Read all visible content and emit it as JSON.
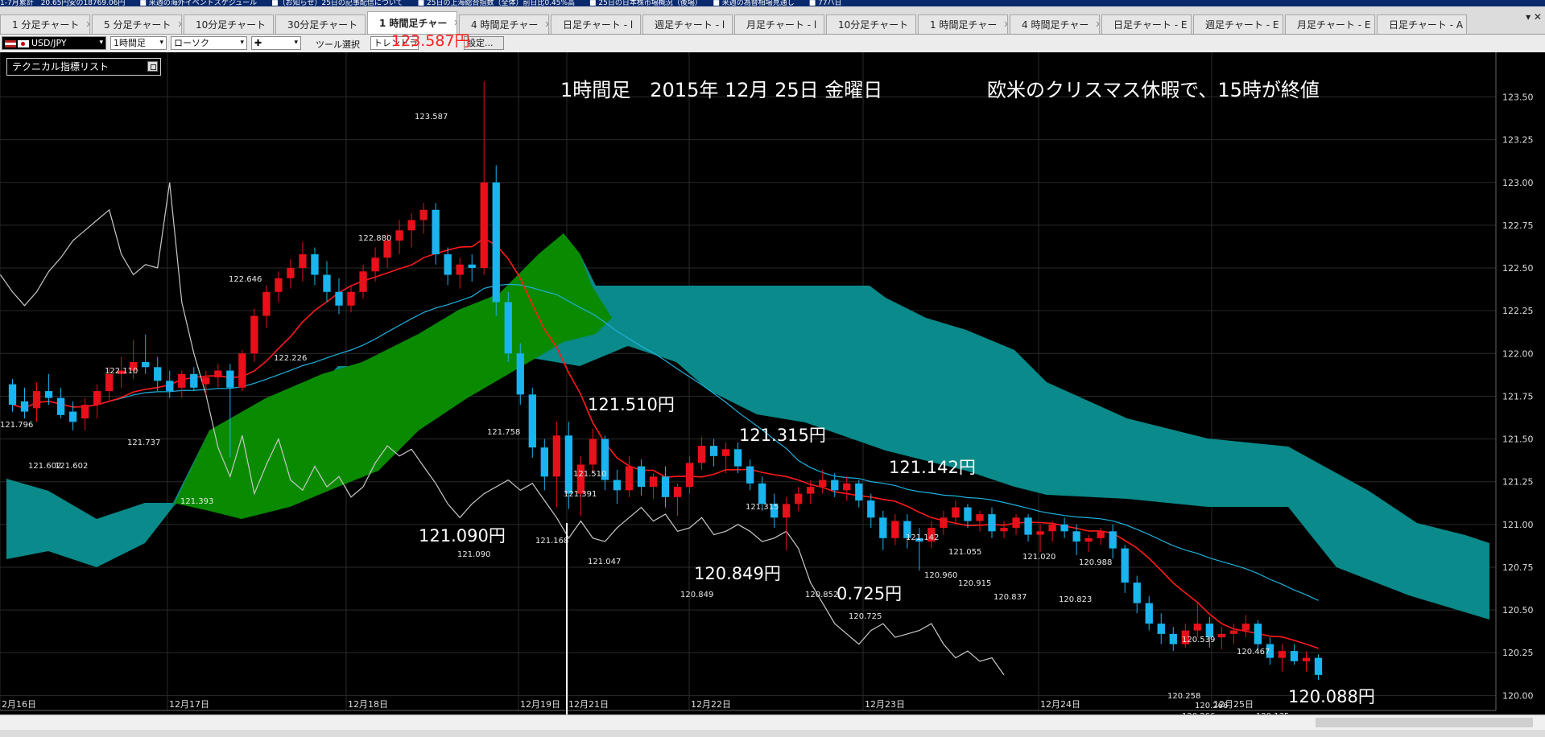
{
  "ticker": {
    "text": "1-7月累計　20.65円安の18769.06円　　■ 来週の海外イベントスケジュール　　■（お知らせ）25日の記事配信について　　■ 25日の上海総合指数（全体）前日比0.45%高　　■ 25日の日本株市場概況（後場）　　■ 来週の為替相場見通し　　■ 77ハ日"
  },
  "tabs": [
    {
      "label": "1 分足チャート"
    },
    {
      "label": "5 分足チャート"
    },
    {
      "label": "10分足チャート"
    },
    {
      "label": "30分足チャート"
    },
    {
      "label": "1 時間足チャー",
      "active": true
    },
    {
      "label": "4 時間足チャー"
    },
    {
      "label": "日足チャート - l"
    },
    {
      "label": "週足チャート - l"
    },
    {
      "label": "月足チャート - l"
    },
    {
      "label": "10分足チャート"
    },
    {
      "label": "1 時間足チャー"
    },
    {
      "label": "4 時間足チャー"
    },
    {
      "label": "日足チャート - E"
    },
    {
      "label": "週足チャート - E"
    },
    {
      "label": "月足チャート - E"
    },
    {
      "label": "日足チャート - A"
    }
  ],
  "tab_controls": "▾ ✕",
  "toolbar": {
    "symbol": "USD/JPY",
    "timeframe": "1時間足",
    "chart_type": "ローソク",
    "drawing": "✚",
    "tool_label": "ツール選択",
    "trend_line": "トレンドライン",
    "settings": "設定..."
  },
  "indicator_list": "テクニカル指標リスト",
  "headline": {
    "title": "1時間足　2015年 12月 25日 金曜日",
    "note": "欧米のクリスマス休暇で、15時が終値"
  },
  "top_price_label": "123.587円",
  "annotations": {
    "a1": "121.510円",
    "a2": "121.315円",
    "a3": "121.142円",
    "a4": "121.090円",
    "a5": "120.849円",
    "a6": "0.725円",
    "a7": "120.088円"
  },
  "chart_data": {
    "type": "candlestick",
    "pair": "USD/JPY",
    "timeframe": "1時間足",
    "ylim": [
      119.95,
      123.62
    ],
    "y_ticks": [
      "123.50",
      "123.25",
      "123.00",
      "122.75",
      "122.50",
      "122.25",
      "122.00",
      "121.75",
      "121.50",
      "121.25",
      "121.00",
      "120.75",
      "120.50",
      "120.25",
      "120.00"
    ],
    "x_labels": [
      "2月16日",
      "12月17日",
      "12月18日",
      "12月19日",
      "12月21日",
      "12月22日",
      "12月23日",
      "12月24日",
      "12月25日"
    ],
    "price_labels": [
      "123.587",
      "122.880",
      "122.646",
      "122.226",
      "122.110",
      "121.796",
      "121.737",
      "121.602",
      "121.602",
      "121.393",
      "121.758",
      "121.510",
      "121.391",
      "121.168",
      "121.090",
      "121.047",
      "121.315",
      "120.849",
      "120.852",
      "120.725",
      "121.142",
      "121.055",
      "120.960",
      "120.915",
      "121.020",
      "120.837",
      "120.988",
      "120.823",
      "120.539",
      "120.467",
      "120.258",
      "120.266",
      "120.266",
      "120.135"
    ],
    "colors": {
      "up": "#e8101a",
      "down": "#1ab4ee",
      "tenkan": "#ff1a1a",
      "kijun": "#1eb0dc",
      "chikou": "#c8c8c8",
      "kumo_bull": "#0a8a00",
      "kumo_bear": "#0a8a8a",
      "grid": "#2a2a2a",
      "annotation": "#ffffff",
      "top_price": "#ff2020"
    },
    "candles": [
      [
        121.82,
        121.85,
        121.66,
        121.7
      ],
      [
        121.72,
        121.8,
        121.62,
        121.66
      ],
      [
        121.68,
        121.83,
        121.6,
        121.78
      ],
      [
        121.78,
        121.88,
        121.7,
        121.74
      ],
      [
        121.74,
        121.8,
        121.62,
        121.64
      ],
      [
        121.66,
        121.72,
        121.55,
        121.6
      ],
      [
        121.62,
        121.74,
        121.55,
        121.7
      ],
      [
        121.7,
        121.82,
        121.62,
        121.78
      ],
      [
        121.78,
        121.92,
        121.72,
        121.88
      ],
      [
        121.88,
        121.98,
        121.8,
        121.9
      ],
      [
        121.9,
        122.08,
        121.85,
        121.95
      ],
      [
        121.95,
        122.11,
        121.88,
        121.92
      ],
      [
        121.92,
        121.98,
        121.78,
        121.84
      ],
      [
        121.84,
        121.9,
        121.74,
        121.78
      ],
      [
        121.8,
        121.9,
        121.74,
        121.88
      ],
      [
        121.88,
        121.92,
        121.78,
        121.8
      ],
      [
        121.82,
        121.9,
        121.76,
        121.86
      ],
      [
        121.86,
        121.94,
        121.8,
        121.9
      ],
      [
        121.9,
        121.94,
        121.39,
        121.8
      ],
      [
        121.8,
        122.02,
        121.78,
        122.0
      ],
      [
        122.0,
        122.26,
        121.95,
        122.22
      ],
      [
        122.22,
        122.4,
        122.15,
        122.36
      ],
      [
        122.36,
        122.48,
        122.3,
        122.44
      ],
      [
        122.44,
        122.55,
        122.38,
        122.5
      ],
      [
        122.5,
        122.65,
        122.42,
        122.58
      ],
      [
        122.58,
        122.62,
        122.4,
        122.46
      ],
      [
        122.46,
        122.54,
        122.3,
        122.36
      ],
      [
        122.36,
        122.44,
        122.23,
        122.28
      ],
      [
        122.28,
        122.4,
        122.24,
        122.36
      ],
      [
        122.36,
        122.52,
        122.32,
        122.48
      ],
      [
        122.48,
        122.62,
        122.42,
        122.56
      ],
      [
        122.56,
        122.7,
        122.5,
        122.66
      ],
      [
        122.66,
        122.78,
        122.58,
        122.72
      ],
      [
        122.72,
        122.82,
        122.62,
        122.78
      ],
      [
        122.78,
        122.88,
        122.7,
        122.84
      ],
      [
        122.84,
        122.88,
        122.52,
        122.58
      ],
      [
        122.58,
        122.62,
        122.4,
        122.46
      ],
      [
        122.46,
        122.56,
        122.38,
        122.52
      ],
      [
        122.52,
        122.58,
        122.42,
        122.5
      ],
      [
        122.5,
        123.59,
        122.46,
        123.0
      ],
      [
        123.0,
        123.1,
        122.22,
        122.3
      ],
      [
        122.3,
        122.36,
        121.95,
        122.0
      ],
      [
        122.0,
        122.06,
        121.7,
        121.76
      ],
      [
        121.76,
        121.8,
        121.39,
        121.45
      ],
      [
        121.45,
        121.5,
        121.2,
        121.28
      ],
      [
        121.28,
        121.6,
        121.1,
        121.52
      ],
      [
        121.52,
        121.6,
        121.09,
        121.18
      ],
      [
        121.18,
        121.4,
        121.05,
        121.35
      ],
      [
        121.35,
        121.56,
        121.3,
        121.5
      ],
      [
        121.5,
        121.52,
        121.2,
        121.26
      ],
      [
        121.26,
        121.32,
        121.12,
        121.2
      ],
      [
        121.2,
        121.4,
        121.16,
        121.34
      ],
      [
        121.34,
        121.38,
        121.17,
        121.22
      ],
      [
        121.22,
        121.3,
        121.15,
        121.28
      ],
      [
        121.28,
        121.34,
        121.1,
        121.16
      ],
      [
        121.16,
        121.24,
        121.05,
        121.22
      ],
      [
        121.22,
        121.4,
        121.18,
        121.36
      ],
      [
        121.36,
        121.51,
        121.32,
        121.46
      ],
      [
        121.46,
        121.5,
        121.34,
        121.4
      ],
      [
        121.4,
        121.48,
        121.3,
        121.44
      ],
      [
        121.44,
        121.48,
        121.3,
        121.34
      ],
      [
        121.34,
        121.38,
        121.2,
        121.24
      ],
      [
        121.24,
        121.28,
        121.08,
        121.12
      ],
      [
        121.12,
        121.18,
        120.98,
        121.04
      ],
      [
        121.04,
        121.16,
        120.85,
        121.12
      ],
      [
        121.12,
        121.22,
        121.08,
        121.18
      ],
      [
        121.18,
        121.26,
        121.12,
        121.22
      ],
      [
        121.22,
        121.32,
        121.18,
        121.26
      ],
      [
        121.26,
        121.3,
        121.16,
        121.2
      ],
      [
        121.2,
        121.28,
        121.14,
        121.24
      ],
      [
        121.24,
        121.26,
        121.1,
        121.14
      ],
      [
        121.14,
        121.18,
        120.98,
        121.04
      ],
      [
        121.04,
        121.08,
        120.85,
        120.92
      ],
      [
        120.92,
        121.06,
        120.88,
        121.02
      ],
      [
        121.02,
        121.06,
        120.86,
        120.92
      ],
      [
        120.92,
        120.98,
        120.73,
        120.9
      ],
      [
        120.9,
        121.02,
        120.86,
        120.98
      ],
      [
        120.98,
        121.08,
        120.94,
        121.04
      ],
      [
        121.04,
        121.14,
        121.0,
        121.1
      ],
      [
        121.1,
        121.12,
        120.98,
        121.02
      ],
      [
        121.02,
        121.08,
        120.96,
        121.06
      ],
      [
        121.06,
        121.1,
        120.92,
        120.96
      ],
      [
        120.96,
        121.02,
        120.92,
        120.98
      ],
      [
        120.98,
        121.06,
        120.94,
        121.04
      ],
      [
        121.04,
        121.06,
        120.9,
        120.94
      ],
      [
        120.94,
        121.0,
        120.84,
        120.96
      ],
      [
        120.96,
        121.02,
        120.9,
        121.0
      ],
      [
        121.0,
        121.04,
        120.92,
        120.96
      ],
      [
        120.96,
        121.0,
        120.82,
        120.9
      ],
      [
        120.9,
        120.94,
        120.84,
        120.92
      ],
      [
        120.92,
        120.98,
        120.88,
        120.96
      ],
      [
        120.96,
        121.0,
        120.8,
        120.86
      ],
      [
        120.86,
        120.88,
        120.6,
        120.66
      ],
      [
        120.66,
        120.7,
        120.48,
        120.54
      ],
      [
        120.54,
        120.58,
        120.38,
        120.42
      ],
      [
        120.42,
        120.48,
        120.3,
        120.36
      ],
      [
        120.36,
        120.4,
        120.26,
        120.3
      ],
      [
        120.3,
        120.42,
        120.28,
        120.38
      ],
      [
        120.38,
        120.54,
        120.34,
        120.42
      ],
      [
        120.42,
        120.46,
        120.28,
        120.34
      ],
      [
        120.34,
        120.4,
        120.27,
        120.36
      ],
      [
        120.36,
        120.42,
        120.3,
        120.38
      ],
      [
        120.38,
        120.47,
        120.34,
        120.42
      ],
      [
        120.42,
        120.44,
        120.26,
        120.3
      ],
      [
        120.3,
        120.34,
        120.18,
        120.22
      ],
      [
        120.22,
        120.3,
        120.14,
        120.26
      ],
      [
        120.26,
        120.3,
        120.18,
        120.2
      ],
      [
        120.2,
        120.26,
        120.14,
        120.22
      ],
      [
        120.22,
        120.24,
        120.09,
        120.12
      ]
    ]
  }
}
